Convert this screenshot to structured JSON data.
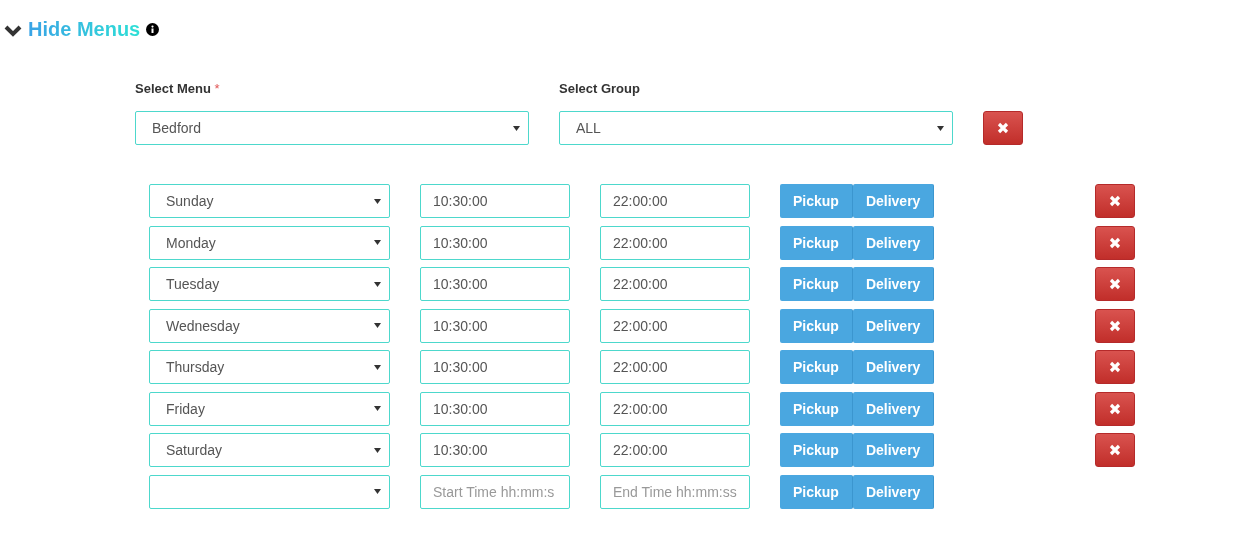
{
  "section": {
    "title": "Hide Menus",
    "expanded": true
  },
  "filters": [
    {
      "label": "Select Menu",
      "required_mark": "*",
      "value": "Bedford"
    },
    {
      "label": "Select Group",
      "value": "ALL"
    }
  ],
  "rows": [
    {
      "kind": "entry",
      "day": "Sunday",
      "start": {
        "value": "10:30:00"
      },
      "end": {
        "value": "22:00:00"
      },
      "buttons": [
        "Pickup",
        "Delivery"
      ]
    },
    {
      "kind": "entry",
      "day": "Monday",
      "start": {
        "value": "10:30:00"
      },
      "end": {
        "value": "22:00:00"
      },
      "buttons": [
        "Pickup",
        "Delivery"
      ]
    },
    {
      "kind": "entry",
      "day": "Tuesday",
      "start": {
        "value": "10:30:00"
      },
      "end": {
        "value": "22:00:00"
      },
      "buttons": [
        "Pickup",
        "Delivery"
      ]
    },
    {
      "kind": "entry",
      "day": "Wednesday",
      "start": {
        "value": "10:30:00"
      },
      "end": {
        "value": "22:00:00"
      },
      "buttons": [
        "Pickup",
        "Delivery"
      ]
    },
    {
      "kind": "entry",
      "day": "Thursday",
      "start": {
        "value": "10:30:00"
      },
      "end": {
        "value": "22:00:00"
      },
      "buttons": [
        "Pickup",
        "Delivery"
      ]
    },
    {
      "kind": "entry",
      "day": "Friday",
      "start": {
        "value": "10:30:00"
      },
      "end": {
        "value": "22:00:00"
      },
      "buttons": [
        "Pickup",
        "Delivery"
      ]
    },
    {
      "kind": "entry",
      "day": "Saturday",
      "start": {
        "value": "10:30:00"
      },
      "end": {
        "value": "22:00:00"
      },
      "buttons": [
        "Pickup",
        "Delivery"
      ]
    },
    {
      "kind": "new",
      "start": {
        "placeholder": "Start Time hh:mm:s"
      },
      "end": {
        "placeholder": "End Time hh:mm:ss"
      },
      "buttons": [
        "Pickup",
        "Delivery"
      ]
    }
  ]
}
